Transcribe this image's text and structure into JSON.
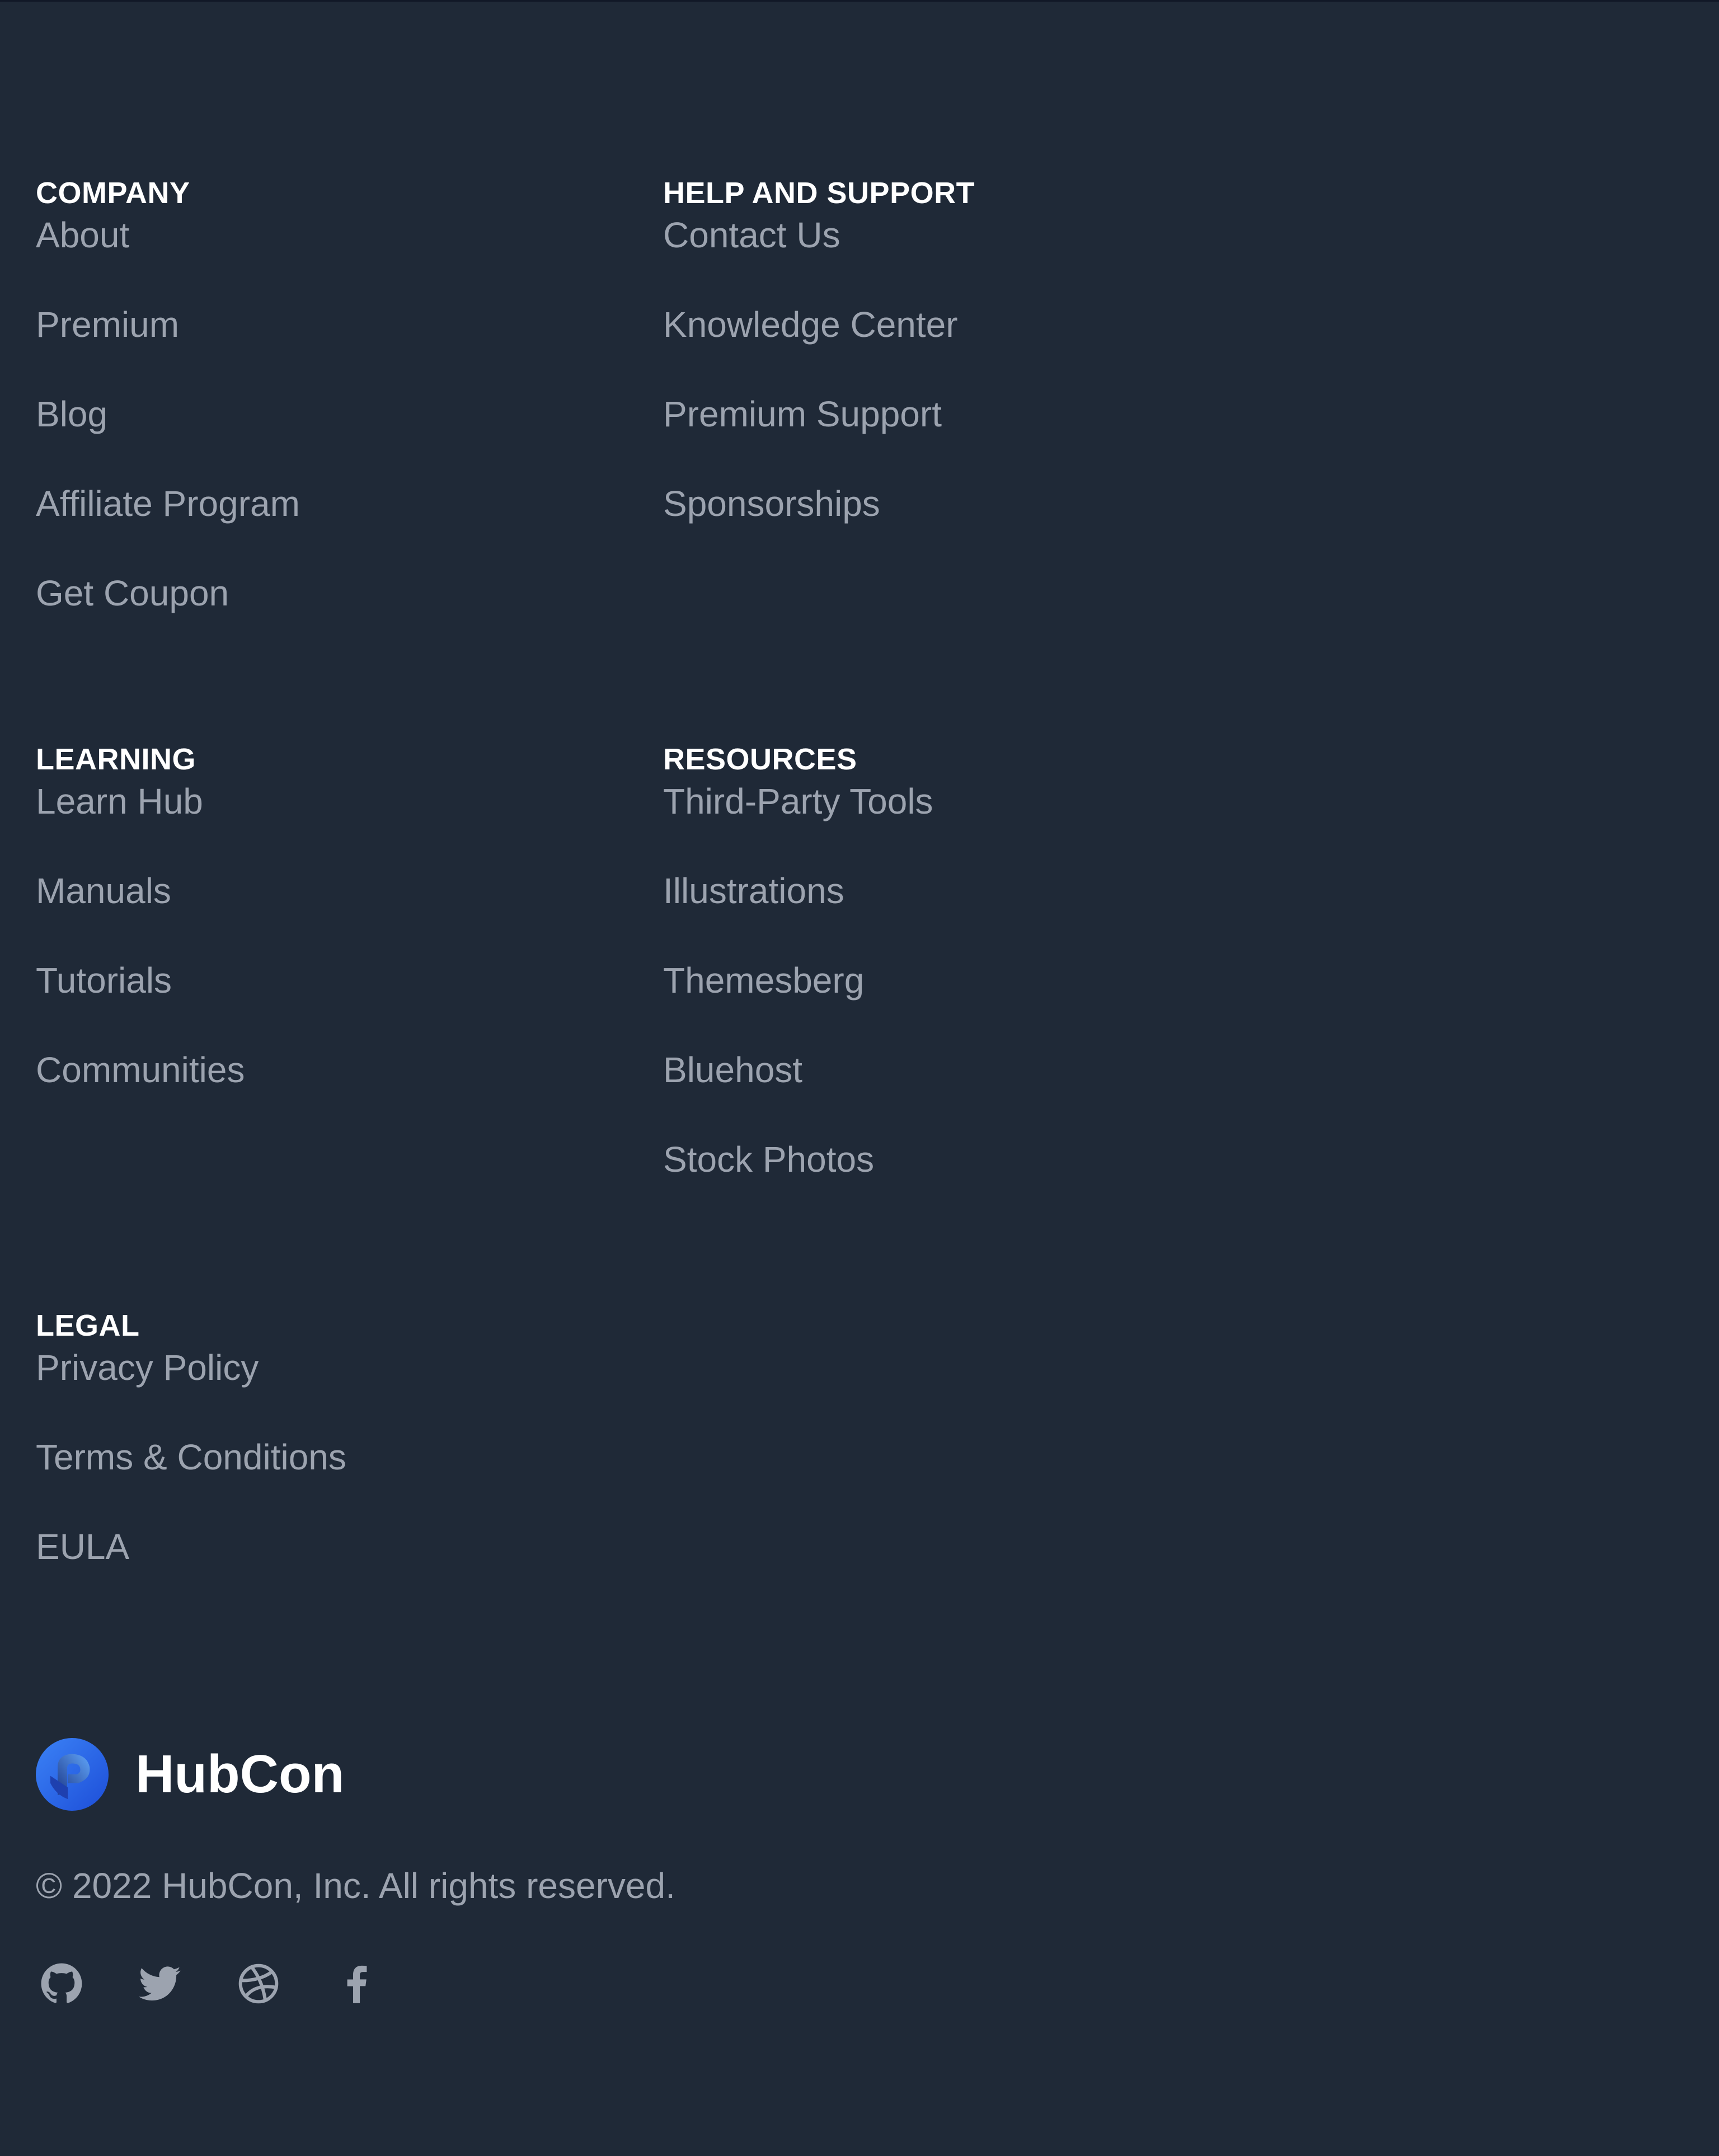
{
  "sections": {
    "company": {
      "title": "COMPANY",
      "links": [
        "About",
        "Premium",
        "Blog",
        "Affiliate Program",
        "Get Coupon"
      ]
    },
    "help": {
      "title": "HELP AND SUPPORT",
      "links": [
        "Contact Us",
        "Knowledge Center",
        "Premium Support",
        "Sponsorships"
      ]
    },
    "learning": {
      "title": "LEARNING",
      "links": [
        "Learn Hub",
        "Manuals",
        "Tutorials",
        "Communities"
      ]
    },
    "resources": {
      "title": "RESOURCES",
      "links": [
        "Third-Party Tools",
        "Illustrations",
        "Themesberg",
        "Bluehost",
        "Stock Photos"
      ]
    },
    "legal": {
      "title": "LEGAL",
      "links": [
        "Privacy Policy",
        "Terms & Conditions",
        "EULA"
      ]
    }
  },
  "brand": {
    "name": "HubCon",
    "logo_icon": "hubcon-logo-icon"
  },
  "copyright": "© 2022 HubCon, Inc. All rights reserved.",
  "social_icons": [
    "github-icon",
    "twitter-icon",
    "dribbble-icon",
    "facebook-icon"
  ],
  "colors": {
    "background": "#1f2937",
    "heading": "#ffffff",
    "link": "#9ca3af",
    "logo_primary": "#1d4ed8",
    "logo_secondary": "#3b82f6"
  }
}
